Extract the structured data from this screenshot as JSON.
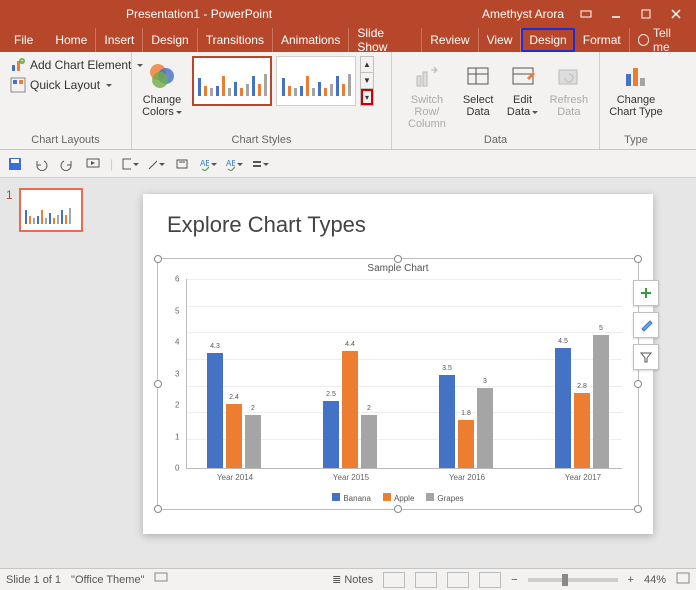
{
  "window": {
    "title": "Presentation1  -  PowerPoint",
    "user": "Amethyst Arora"
  },
  "tabs": {
    "file": "File",
    "home": "Home",
    "insert": "Insert",
    "design": "Design",
    "transitions": "Transitions",
    "animations": "Animations",
    "slideshow": "Slide Show",
    "review": "Review",
    "view": "View",
    "ctdesign": "Design",
    "format": "Format",
    "tellme": "Tell me"
  },
  "ribbon": {
    "layouts": {
      "add": "Add Chart Element",
      "quick": "Quick Layout",
      "label": "Chart Layouts"
    },
    "colors": {
      "change": "Change Colors"
    },
    "styles": {
      "label": "Chart Styles"
    },
    "data": {
      "switch": "Switch Row/\nColumn",
      "select": "Select\nData",
      "edit": "Edit\nData",
      "refresh": "Refresh\nData",
      "label": "Data"
    },
    "type": {
      "change": "Change\nChart Type",
      "label": "Type"
    }
  },
  "slide": {
    "title": "Explore Chart Types",
    "number": "1"
  },
  "status": {
    "slide": "Slide 1 of 1",
    "theme": "\"Office Theme\"",
    "notes": "Notes",
    "zoom": "44%"
  },
  "chart_data": {
    "type": "bar",
    "title": "Sample Chart",
    "categories": [
      "Year 2014",
      "Year 2015",
      "Year 2016",
      "Year 2017"
    ],
    "series": [
      {
        "name": "Banana",
        "color": "#4472c4",
        "values": [
          4.3,
          2.5,
          3.5,
          4.5
        ]
      },
      {
        "name": "Apple",
        "color": "#ed7d31",
        "values": [
          2.4,
          4.4,
          1.8,
          2.8
        ]
      },
      {
        "name": "Grapes",
        "color": "#a5a5a5",
        "values": [
          2,
          2,
          3,
          5
        ]
      }
    ],
    "ylim": [
      0,
      6
    ],
    "yticks": [
      0,
      1,
      2,
      3,
      4,
      5,
      6
    ]
  }
}
